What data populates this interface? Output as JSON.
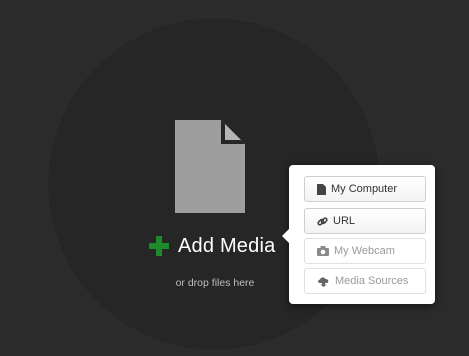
{
  "dropzone": {
    "add_media_label": "Add Media",
    "drop_hint": "or drop files here",
    "plus_color": "#1f8a2a",
    "file_icon_color": "#9e9e9e"
  },
  "source_menu": {
    "options": [
      {
        "label": "My Computer",
        "icon": "file-icon",
        "enabled": true
      },
      {
        "label": "URL",
        "icon": "link-icon",
        "enabled": true
      },
      {
        "label": "My Webcam",
        "icon": "camera-icon",
        "enabled": false
      },
      {
        "label": "Media Sources",
        "icon": "cloud-download-icon",
        "enabled": false
      }
    ]
  }
}
